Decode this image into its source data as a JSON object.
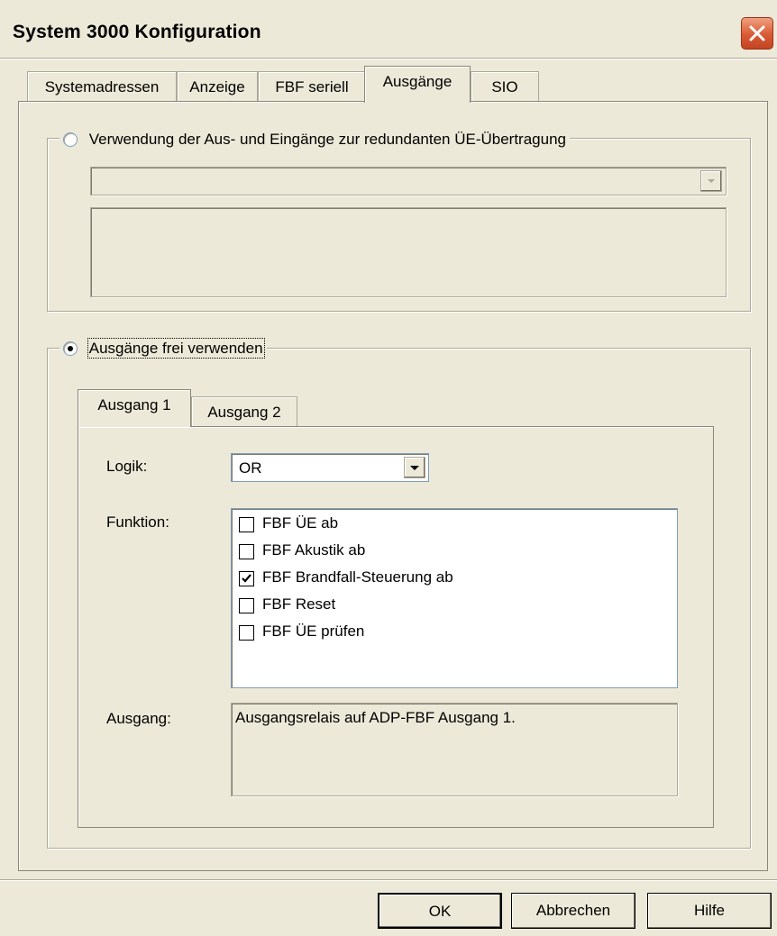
{
  "window": {
    "title": "System 3000 Konfiguration"
  },
  "tabs": [
    {
      "label": "Systemadressen",
      "active": false
    },
    {
      "label": "Anzeige",
      "active": false
    },
    {
      "label": "FBF seriell",
      "active": false
    },
    {
      "label": "Ausgänge",
      "active": true
    },
    {
      "label": "SIO",
      "active": false
    }
  ],
  "group_redundant": {
    "label": "Verwendung der Aus- und Eingänge zur redundanten ÜE-Übertragung",
    "selected": false,
    "dropdown_value": "",
    "description": ""
  },
  "group_free": {
    "label": "Ausgänge frei verwenden",
    "selected": true,
    "subtabs": [
      {
        "label": "Ausgang 1",
        "active": true
      },
      {
        "label": "Ausgang 2",
        "active": false
      }
    ],
    "logik": {
      "label": "Logik:",
      "value": "OR"
    },
    "funktion": {
      "label": "Funktion:",
      "items": [
        {
          "label": "FBF ÜE ab",
          "checked": false
        },
        {
          "label": "FBF Akustik ab",
          "checked": false
        },
        {
          "label": "FBF Brandfall-Steuerung ab",
          "checked": true
        },
        {
          "label": "FBF Reset",
          "checked": false
        },
        {
          "label": "FBF ÜE prüfen",
          "checked": false
        }
      ]
    },
    "ausgang": {
      "label": "Ausgang:",
      "value": "Ausgangsrelais auf ADP-FBF Ausgang 1."
    }
  },
  "buttons": {
    "ok": "OK",
    "cancel": "Abbrechen",
    "help": "Hilfe"
  },
  "colors": {
    "dialog_bg": "#ece9d8",
    "close_button": "#d85a34"
  }
}
